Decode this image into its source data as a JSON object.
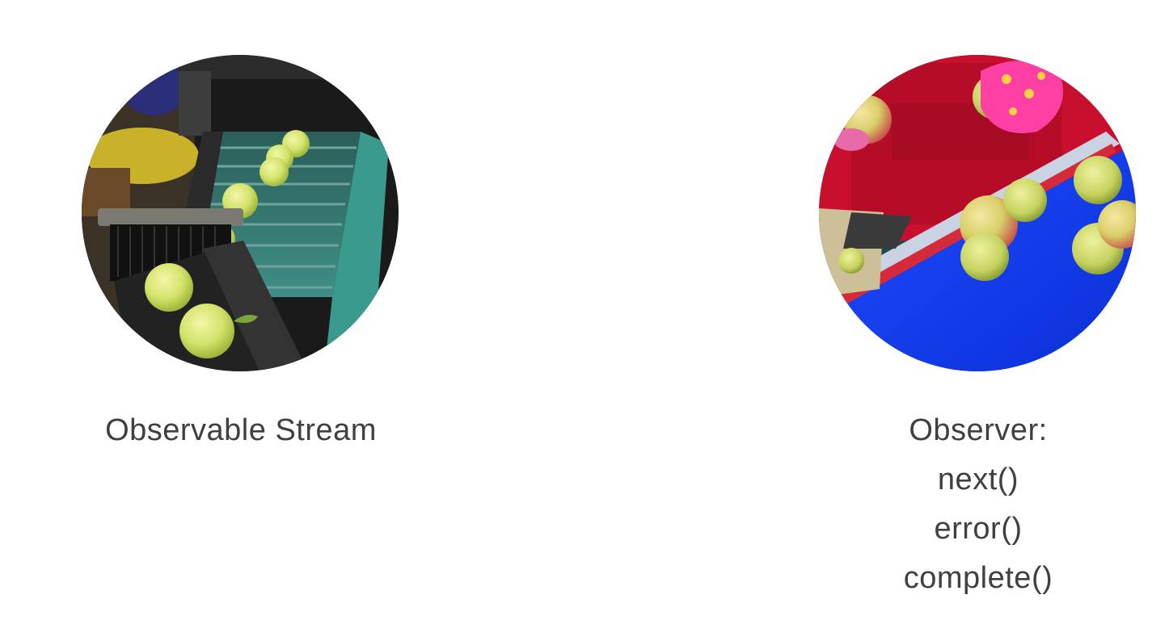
{
  "left": {
    "caption": "Observable Stream",
    "image_subject": "apples-on-sorting-conveyor"
  },
  "right": {
    "caption_lines": [
      "Observer:",
      "next()",
      "error()",
      "complete()"
    ],
    "image_subject": "worker-picking-apples-from-blue-conveyor"
  },
  "colors": {
    "text": "#404040",
    "background": "#ffffff",
    "apple_green": "#d6e86a",
    "conveyor_teal": "#3f8f86",
    "conveyor_blue": "#1438e0",
    "apron_red": "#c8102e",
    "glove_pink": "#ff3fa4"
  }
}
